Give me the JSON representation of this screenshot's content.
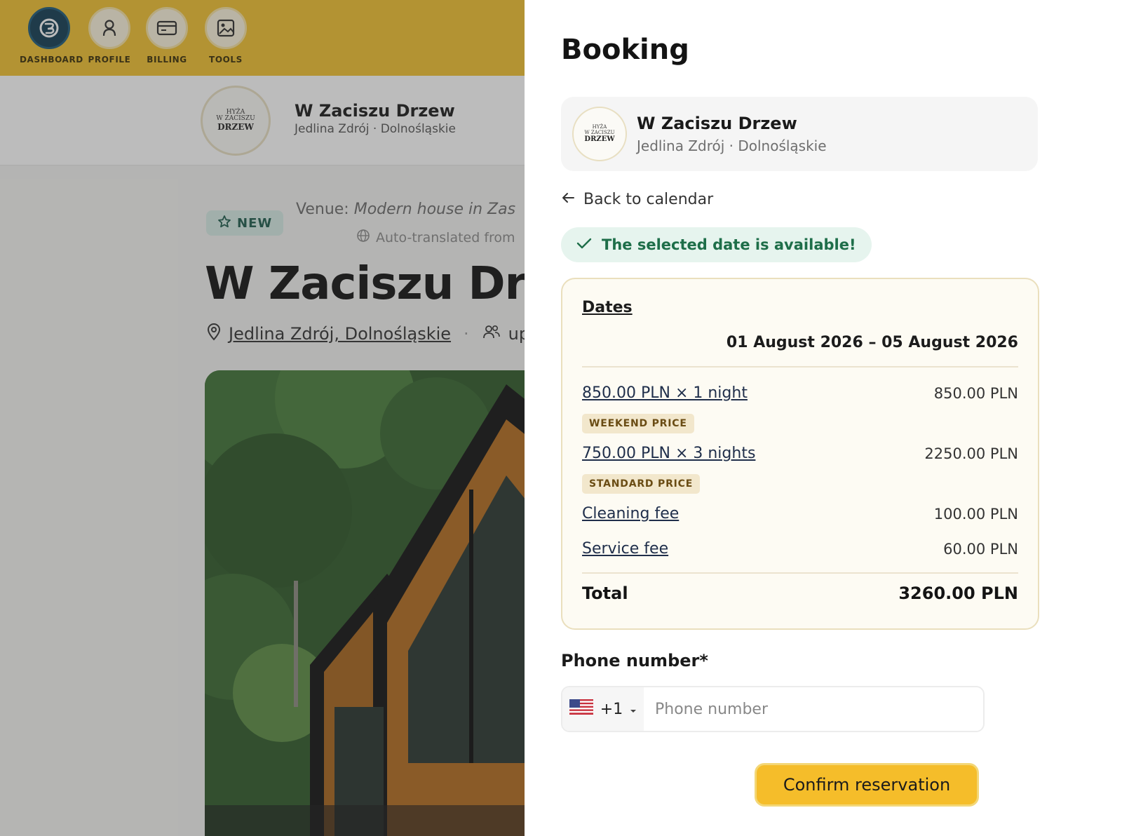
{
  "nav": {
    "items": [
      {
        "label": "DASHBOARD",
        "icon": "dashboard-icon",
        "active": true
      },
      {
        "label": "PROFILE",
        "icon": "user-icon",
        "active": false
      },
      {
        "label": "BILLING",
        "icon": "credit-card-icon",
        "active": false
      },
      {
        "label": "TOOLS",
        "icon": "image-icon",
        "active": false
      }
    ]
  },
  "background_page": {
    "venue_name": "W Zaciszu Drzew",
    "venue_location": "Jedlina Zdrój · Dolnośląskie",
    "logo_text": [
      "HYŻA",
      "W ZACISZU",
      "DRZEW"
    ],
    "badge": "NEW",
    "venue_prefix": "Venue:",
    "venue_value": "Modern house in Zas",
    "auto_translated": "Auto-translated from",
    "big_title": "W Zaciszu Drze",
    "location_link": "Jedlina Zdrój, Dolnośląskie",
    "guests_partial": "up",
    "overlay_color": "#3c3c3c"
  },
  "booking": {
    "title": "Booking",
    "venue_name": "W Zaciszu Drzew",
    "venue_location": "Jedlina Zdrój · Dolnośląskie",
    "back_link": "Back to calendar",
    "availability": "The selected date is available!",
    "dates_label": "Dates",
    "dates_range": "01 August 2026 – 05 August 2026",
    "lines": [
      {
        "label": "850.00 PLN × 1 night",
        "value": "850.00 PLN",
        "tag": "WEEKEND PRICE"
      },
      {
        "label": "750.00 PLN × 3 nights",
        "value": "2250.00 PLN",
        "tag": "STANDARD PRICE"
      },
      {
        "label": "Cleaning fee",
        "value": "100.00 PLN"
      },
      {
        "label": "Service fee",
        "value": "60.00 PLN"
      }
    ],
    "total_label": "Total",
    "total_value": "3260.00 PLN",
    "phone_label": "Phone number*",
    "country_code": "+1",
    "phone_placeholder": "Phone number",
    "confirm_label": "Confirm reservation"
  },
  "colors": {
    "nav_bg": "#f1c12f",
    "accent_button": "#f5bd2a",
    "available_green": "#1e6e49",
    "price_box_bg": "#fdfbf3",
    "dashboard_active": "#123c52"
  }
}
